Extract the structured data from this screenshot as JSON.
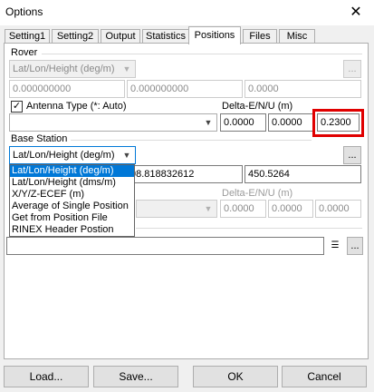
{
  "window": {
    "title": "Options",
    "close_glyph": "✕"
  },
  "tabs": [
    {
      "label": "Setting1"
    },
    {
      "label": "Setting2"
    },
    {
      "label": "Output"
    },
    {
      "label": "Statistics"
    },
    {
      "label": "Positions",
      "active": true
    },
    {
      "label": "Files"
    },
    {
      "label": "Misc"
    }
  ],
  "rover": {
    "group_label": "Rover",
    "format_select": "Lat/Lon/Height (deg/m)",
    "browse_label": "...",
    "lat": "0.000000000",
    "lon": "0.000000000",
    "height": "0.0000",
    "antenna_checked": true,
    "antenna_label": "Antenna Type (*: Auto)",
    "antenna_select": "",
    "delta_label": "Delta-E/N/U (m)",
    "delta_e": "0.0000",
    "delta_n": "0.0000",
    "delta_u": "0.2300"
  },
  "base": {
    "group_label": "Base Station",
    "format_select": "Lat/Lon/Height (deg/m)",
    "browse_label": "...",
    "lon_partial": "98.818832612",
    "height": "450.5264",
    "delta_label": "Delta-E/N/U (m)",
    "delta_e": "0.0000",
    "delta_n": "0.0000",
    "delta_u": "0.0000",
    "dropdown_options": [
      "Lat/Lon/Height (deg/m)",
      "Lat/Lon/Height (dms/m)",
      "X/Y/Z-ECEF (m)",
      "Average of Single Position",
      "Get from Position File",
      "RINEX Header Postion"
    ]
  },
  "station_file": {
    "value": "",
    "browse_label": "..."
  },
  "buttons": {
    "load": "Load...",
    "save": "Save...",
    "ok": "OK",
    "cancel": "Cancel"
  },
  "colors": {
    "accent": "#0078d7",
    "highlight": "#e00000"
  }
}
